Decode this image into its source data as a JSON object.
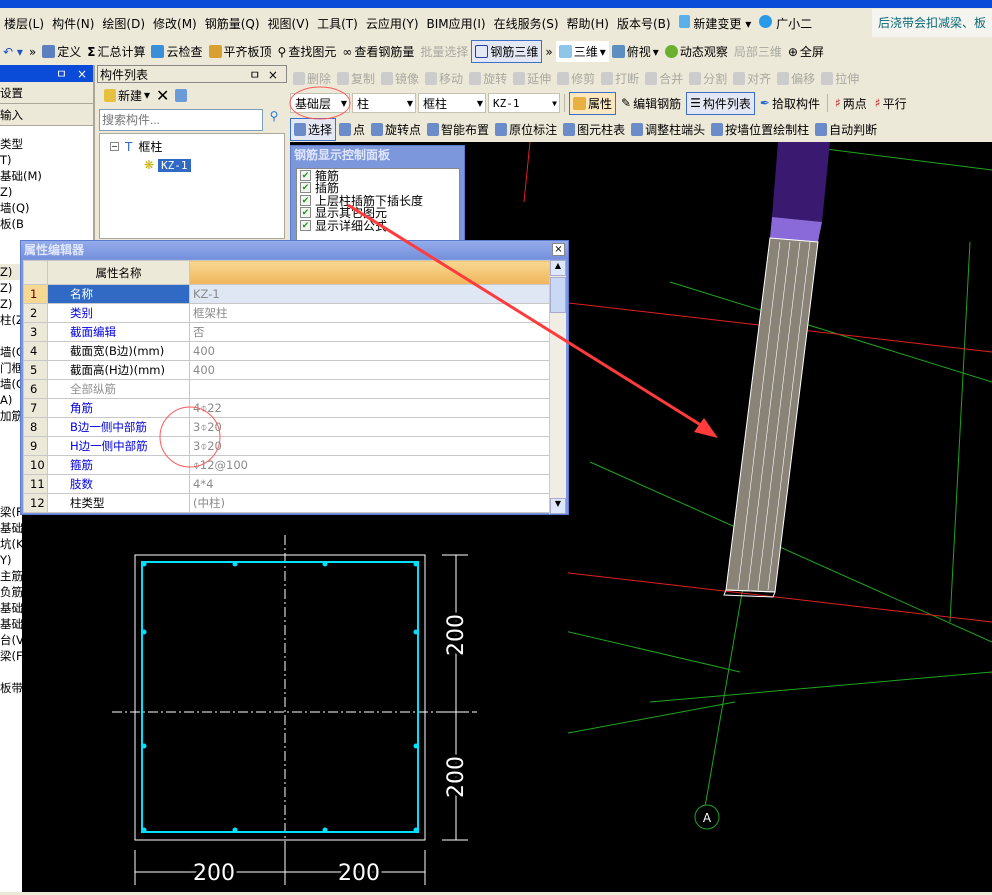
{
  "menu": [
    "楼层(L)",
    "构件(N)",
    "绘图(D)",
    "修改(M)",
    "钢筋量(Q)",
    "视图(V)",
    "工具(T)",
    "云应用(Y)",
    "BIM应用(I)",
    "在线服务(S)",
    "帮助(H)",
    "版本号(B)",
    "新建变更",
    "广小二"
  ],
  "news": "后浇带会扣减梁、板",
  "toolbar1": [
    "定义",
    "汇总计算",
    "云检查",
    "平齐板顶",
    "查找图元",
    "查看钢筋量",
    "批量选择",
    "钢筋三维",
    "三维",
    "俯视",
    "动态观察",
    "局部三维",
    "全屏"
  ],
  "toolbar2": [
    "删除",
    "复制",
    "镜像",
    "移动",
    "旋转",
    "延伸",
    "修剪",
    "打断",
    "合并",
    "分割",
    "对齐",
    "偏移",
    "拉伸"
  ],
  "selectors": {
    "floor": "基础层",
    "type": "柱",
    "subtype": "框柱",
    "name": "KZ-1"
  },
  "toolbar3": [
    "属性",
    "编辑钢筋",
    "构件列表",
    "拾取构件",
    "两点",
    "平行"
  ],
  "toolbar4": [
    "选择",
    "点",
    "旋转点",
    "智能布置",
    "原位标注",
    "图元柱表",
    "调整柱端头",
    "按墙位置绘制柱",
    "自动判断"
  ],
  "left_panel": {
    "items_top": [
      "设置",
      "输入"
    ],
    "tree": [
      "类型",
      "T)",
      "基础(M)",
      "Z)",
      "墙(Q)",
      "板(B",
      "",
      "",
      "Z)",
      "Z)",
      "Z)",
      "柱(Z",
      "",
      "墙(Q",
      "门框",
      "墙(Q",
      "A)",
      "加筋",
      "",
      "",
      "",
      "",
      "",
      "梁(F",
      "基础",
      "坑(K",
      "Y)",
      "主筋",
      "负筋",
      "基础",
      "基础",
      "台(V",
      "梁(F",
      "",
      "板带"
    ]
  },
  "component_list": {
    "title": "构件列表",
    "new_label": "新建",
    "search_placeholder": "搜索构件...",
    "tree_parent": "框柱",
    "tree_child": "KZ-1"
  },
  "rebar_panel": {
    "title": "钢筋显示控制面板",
    "options": [
      "箍筋",
      "插筋",
      "上层柱插筋下插长度",
      "显示其它图元",
      "显示详细公式"
    ]
  },
  "prop_editor": {
    "title": "属性编辑器",
    "header": "属性名称",
    "rows": [
      {
        "n": "1",
        "k": "名称",
        "v": "KZ-1",
        "c": "sel"
      },
      {
        "n": "2",
        "k": "类别",
        "v": "框架柱",
        "c": "blue"
      },
      {
        "n": "3",
        "k": "截面编辑",
        "v": "否",
        "c": "blue"
      },
      {
        "n": "4",
        "k": "截面宽(B边)(mm)",
        "v": "400",
        "c": ""
      },
      {
        "n": "5",
        "k": "截面高(H边)(mm)",
        "v": "400",
        "c": ""
      },
      {
        "n": "6",
        "k": "全部纵筋",
        "v": "",
        "c": "gray"
      },
      {
        "n": "7",
        "k": "角筋",
        "v": "4⌽22",
        "c": "blue"
      },
      {
        "n": "8",
        "k": "B边一侧中部筋",
        "v": "3⌽20",
        "c": "blue"
      },
      {
        "n": "9",
        "k": "H边一侧中部筋",
        "v": "3⌽20",
        "c": "blue"
      },
      {
        "n": "10",
        "k": "箍筋",
        "v": "⌽12@100",
        "c": "blue"
      },
      {
        "n": "11",
        "k": "肢数",
        "v": "4*4",
        "c": "blue"
      },
      {
        "n": "12",
        "k": "柱类型",
        "v": "(中柱)",
        "c": ""
      }
    ]
  },
  "section": {
    "dim_h1": "200",
    "dim_h2": "200",
    "dim_w1": "200",
    "dim_w2": "200"
  },
  "axis_label": "A",
  "colors": {
    "accent": "#0a4bd8",
    "annotation": "#ff3b3b",
    "rebar": "#00e0ff"
  }
}
